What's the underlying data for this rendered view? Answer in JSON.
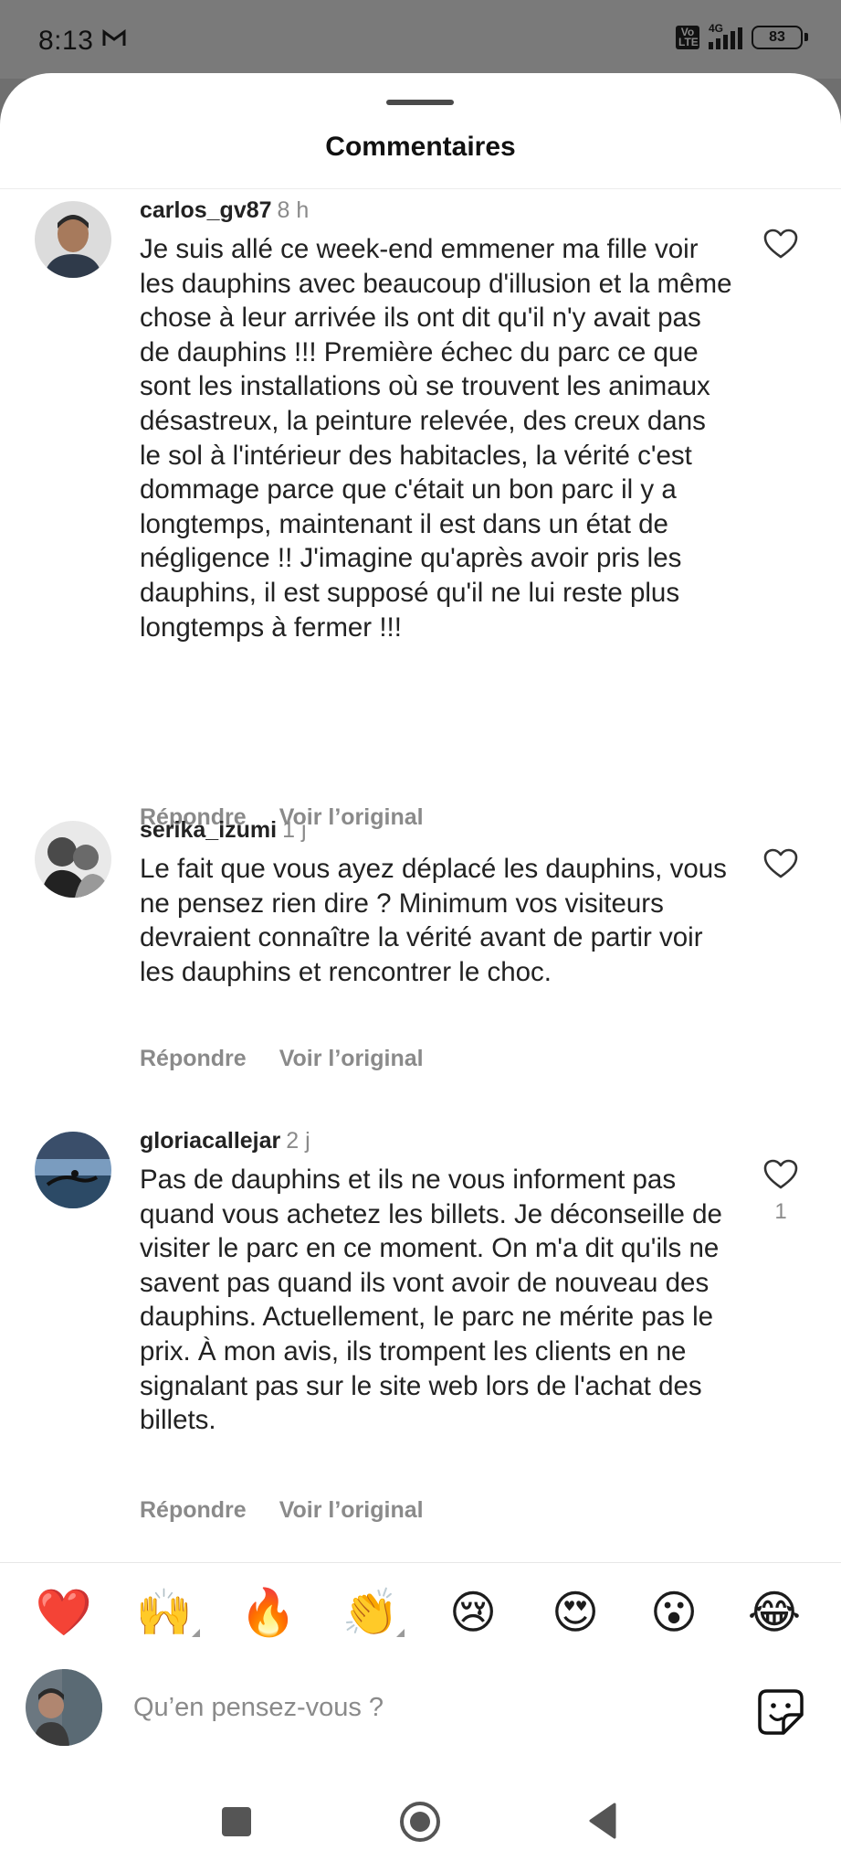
{
  "status_bar": {
    "time": "8:13",
    "network": "4G",
    "volte": "Vo LTE",
    "battery": "83"
  },
  "header": {
    "title": "Commentaires"
  },
  "comments": [
    {
      "username": "carlos_gv87",
      "time": "8 h",
      "text": "Je suis allé ce week-end emmener ma fille voir les dauphins avec beaucoup d'illusion et la même chose à leur arrivée ils ont dit qu'il n'y avait pas de dauphins !!! Première échec du parc ce que sont les installations où se trouvent les animaux désastreux, la peinture relevée, des creux dans le sol à l'intérieur des habitacles, la vérité c'est dommage parce que c'était un bon parc il y a longtemps, maintenant il est dans un état de négligence !! J'imagine qu'après avoir pris les dauphins, il est supposé qu'il ne lui reste plus longtemps à fermer !!!",
      "reply_label": "Répondre",
      "original_label": "Voir l’original",
      "likes": ""
    },
    {
      "username": "serika_izumi",
      "time": "1 j",
      "text": "Le fait que vous ayez déplacé les dauphins, vous ne pensez rien dire ? Minimum vos visiteurs devraient connaître la vérité avant de partir voir les dauphins et rencontrer le choc.",
      "reply_label": "Répondre",
      "original_label": "Voir l’original",
      "likes": ""
    },
    {
      "username": "gloriacallejar",
      "time": "2 j",
      "text": "Pas de dauphins et ils ne vous informent pas quand vous achetez les billets. Je déconseille de visiter le parc en ce moment. On m'a dit qu'ils ne savent pas quand ils vont avoir de nouveau des dauphins. Actuellement, le parc ne mérite pas le prix. À mon avis, ils trompent les clients en ne signalant pas sur le site web lors de l'achat des billets.",
      "reply_label": "Répondre",
      "original_label": "Voir l’original",
      "likes": "1"
    }
  ],
  "reactions": [
    "❤️",
    "🙌",
    "🔥",
    "👏",
    "😢",
    "😍",
    "😮",
    "😂"
  ],
  "composer": {
    "placeholder": "Qu’en pensez-vous ?"
  },
  "colors": {
    "sheet": "#ffffff",
    "scrim": "#7a7a7a",
    "muted": "#8a8a8a",
    "heart": "#e0245e"
  }
}
